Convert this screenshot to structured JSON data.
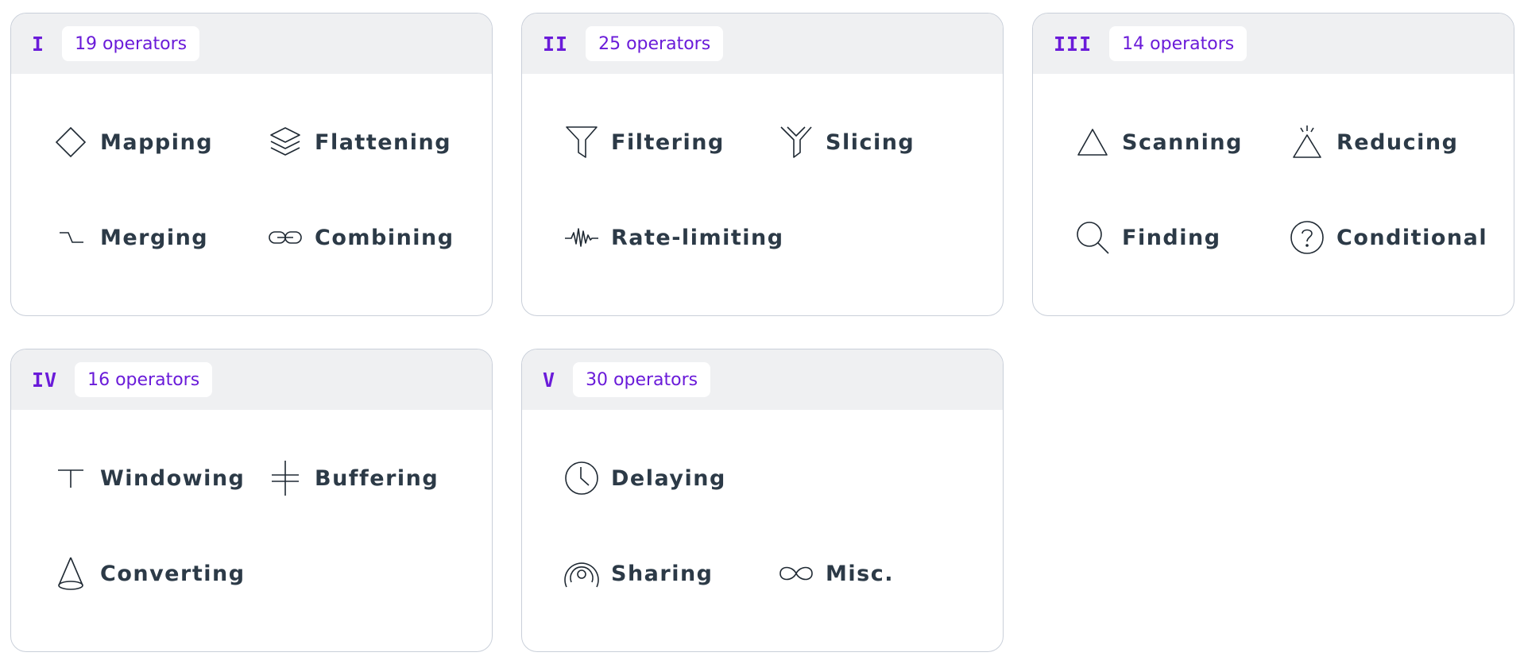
{
  "cards": [
    {
      "numeral": "I",
      "count": "19 operators",
      "items": [
        {
          "label": "Mapping",
          "icon": "diamond-icon"
        },
        {
          "label": "Flattening",
          "icon": "layers-icon"
        },
        {
          "label": "Merging",
          "icon": "merge-lines-icon"
        },
        {
          "label": "Combining",
          "icon": "chain-link-icon"
        }
      ]
    },
    {
      "numeral": "II",
      "count": "25 operators",
      "items": [
        {
          "label": "Filtering",
          "icon": "funnel-icon"
        },
        {
          "label": "Slicing",
          "icon": "sliced-funnel-icon"
        },
        {
          "label": "Rate-limiting",
          "icon": "waveform-icon"
        }
      ]
    },
    {
      "numeral": "III",
      "count": "14 operators",
      "items": [
        {
          "label": "Scanning",
          "icon": "triangle-icon"
        },
        {
          "label": "Reducing",
          "icon": "sparkle-triangle-icon"
        },
        {
          "label": "Finding",
          "icon": "magnifier-icon"
        },
        {
          "label": "Conditional",
          "icon": "question-circle-icon"
        }
      ]
    },
    {
      "numeral": "IV",
      "count": "16 operators",
      "items": [
        {
          "label": "Windowing",
          "icon": "tee-icon"
        },
        {
          "label": "Buffering",
          "icon": "buffer-cross-icon"
        },
        {
          "label": "Converting",
          "icon": "cone-icon"
        }
      ]
    },
    {
      "numeral": "V",
      "count": "30 operators",
      "items": [
        {
          "label": "Delaying",
          "icon": "clock-icon"
        },
        {
          "label": "Sharing",
          "icon": "broadcast-icon"
        },
        {
          "label": "Misc.",
          "icon": "infinity-icon"
        }
      ]
    }
  ],
  "colors": {
    "accent": "#6a1bd9",
    "text": "#2c3a47",
    "header_bg": "#eff0f2",
    "border": "#c9cfd9"
  }
}
